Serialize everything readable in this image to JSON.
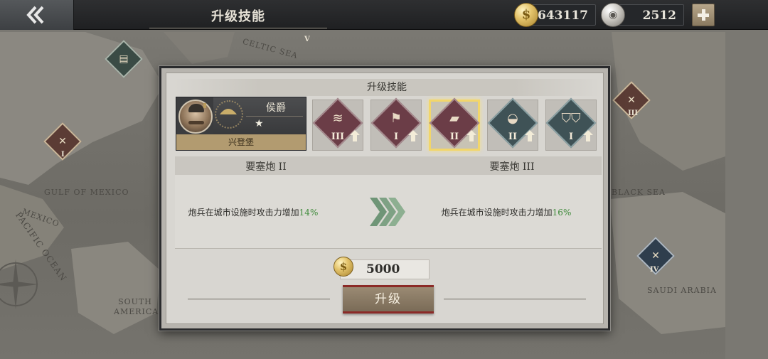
{
  "topbar": {
    "title": "升级技能",
    "gold_amount": "643117",
    "silver_amount": "2512"
  },
  "map": {
    "labels": [
      "GULF OF MEXICO",
      "MEXICO",
      "PACIFIC OCEAN",
      "SOUTH AMERICA",
      "SAUDI ARABIA",
      "BLACK SEA",
      "CELTIC SEA"
    ],
    "marker_levels": [
      "I",
      "III",
      "IV",
      "V"
    ]
  },
  "dialog": {
    "title": "升级技能",
    "general": {
      "rank": "侯爵",
      "stars": "★",
      "name": "兴登堡"
    },
    "skills": [
      {
        "level": "III",
        "color": "red",
        "icon": "infantry-icon",
        "upgradable": true
      },
      {
        "level": "I",
        "color": "red",
        "icon": "fortification-icon",
        "upgradable": true
      },
      {
        "level": "II",
        "color": "red",
        "icon": "fortress-cannon-icon",
        "upgradable": true,
        "selected": true
      },
      {
        "level": "II",
        "color": "teal",
        "icon": "shield-badge-icon",
        "upgradable": true
      },
      {
        "level": "I",
        "color": "teal",
        "icon": "double-shield-icon",
        "upgradable": true
      }
    ],
    "current": {
      "name": "要塞炮 II",
      "effect_prefix": "炮兵在城市设施时攻击力增加",
      "effect_value": "14%"
    },
    "next": {
      "name": "要塞炮 III",
      "effect_prefix": "炮兵在城市设施时攻击力增加",
      "effect_value": "16%"
    },
    "cost": "5000",
    "upgrade_label": "升级"
  },
  "colors": {
    "accent_gold": "#f2d66a",
    "effect_green": "#3e8a3a",
    "button_border_red": "#8b2a27"
  }
}
